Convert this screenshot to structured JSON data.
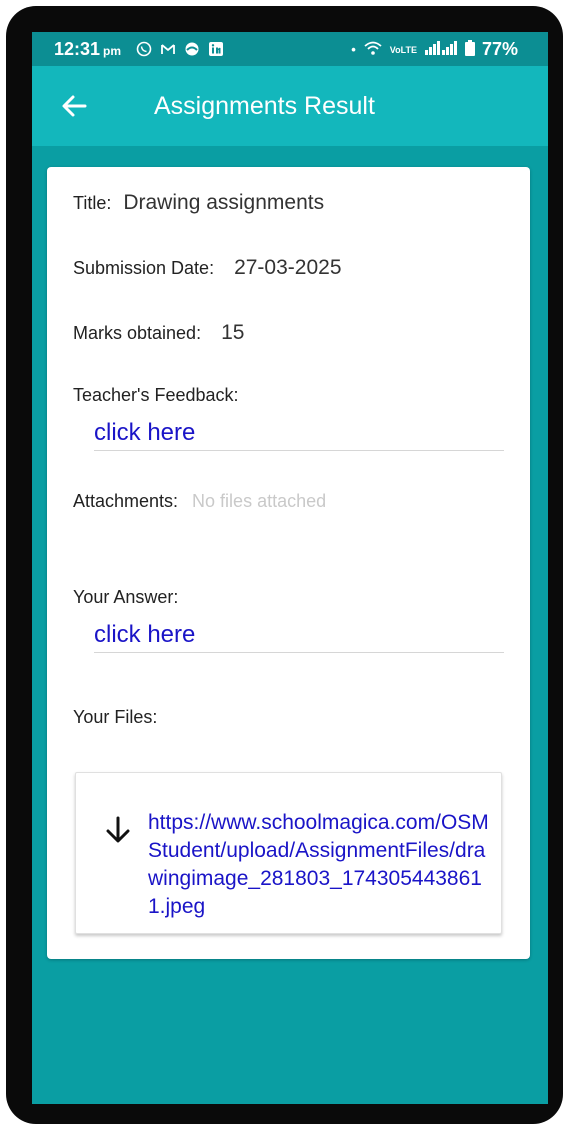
{
  "status_bar": {
    "time": "12:31",
    "ampm": "pm",
    "notification_icons": [
      "whatsapp-icon",
      "gmail-icon",
      "app-icon",
      "linkedin-icon"
    ],
    "signal": "VoLTE",
    "battery": "77%"
  },
  "header": {
    "title": "Assignments Result",
    "back_icon": "arrow-left-icon"
  },
  "details": {
    "title_label": "Title:",
    "title_value": "Drawing assignments",
    "submission_label": "Submission Date:",
    "submission_value": "27-03-2025",
    "marks_label": "Marks obtained:",
    "marks_value": "15",
    "feedback_label": "Teacher's Feedback:",
    "feedback_link": "click here",
    "attachments_label": "Attachments:",
    "attachments_value": "No files attached",
    "answer_label": "Your Answer:",
    "answer_link": "click here",
    "files_label": "Your Files:",
    "file_url": "https://www.schoolmagica.com/OSMStudent/upload/AssignmentFiles/drawingimage_281803_1743054438611.jpeg"
  },
  "colors": {
    "appbar": "#13b7bc",
    "background": "#0a9ea3",
    "link": "#1a14c7"
  }
}
